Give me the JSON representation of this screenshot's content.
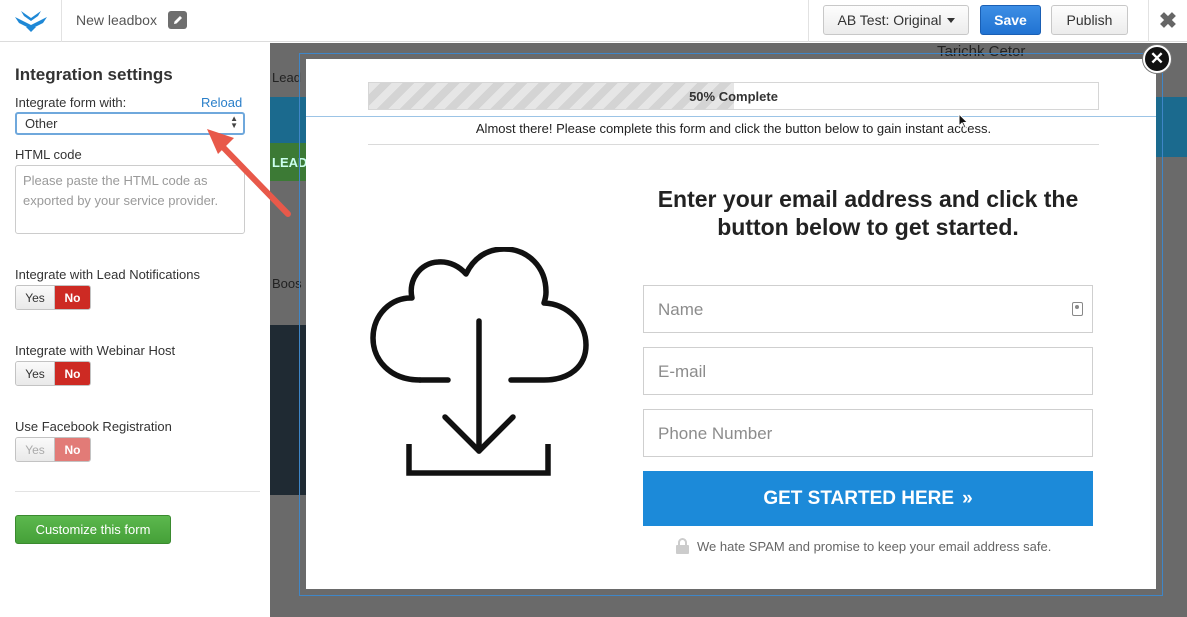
{
  "topbar": {
    "title": "New leadbox",
    "ab_test_label": "AB Test: Original",
    "save_label": "Save",
    "publish_label": "Publish",
    "close_glyph": "✖"
  },
  "sidebar": {
    "heading": "Integration settings",
    "integrate_label": "Integrate form with:",
    "reload_label": "Reload",
    "integration_select": {
      "selected": "Other"
    },
    "html_code_label": "HTML code",
    "html_code_placeholder": "Please paste the HTML code as exported by your service provider.",
    "toggles": [
      {
        "label": "Integrate with Lead Notifications",
        "yes": "Yes",
        "no": "No",
        "value": "No",
        "disabled": false
      },
      {
        "label": "Integrate with Webinar Host",
        "yes": "Yes",
        "no": "No",
        "value": "No",
        "disabled": false
      },
      {
        "label": "Use Facebook Registration",
        "yes": "Yes",
        "no": "No",
        "value": "No",
        "disabled": true
      }
    ],
    "customize_label": "Customize this form"
  },
  "background_page": {
    "text_fragments": [
      "Lead",
      "LEAD",
      "Boos",
      "Tarichk Cetor"
    ]
  },
  "modal": {
    "progress": {
      "percent": 50,
      "label": "50% Complete"
    },
    "subnote": "Almost there! Please complete this form and click the button below to gain instant access.",
    "headline": "Enter your email address and click the button below to get started.",
    "fields": [
      {
        "placeholder": "Name"
      },
      {
        "placeholder": "E-mail"
      },
      {
        "placeholder": "Phone Number"
      }
    ],
    "cta_label": "GET STARTED HERE",
    "cta_glyph": "»",
    "spam_note": "We hate SPAM and promise to keep your email address safe.",
    "close_glyph": "✕"
  },
  "colors": {
    "save_blue": "#2173d2",
    "cta_blue": "#1c8ad9",
    "toggle_no_red": "#cd2a23",
    "customize_green": "#45a038",
    "annotation_arrow": "#e8594a",
    "link_blue": "#2a7fc9"
  },
  "icons": [
    "leadpages-logo-icon",
    "pencil-edit-icon",
    "caret-down-icon",
    "close-icon",
    "select-arrows-icon",
    "cloud-download-icon",
    "contact-card-icon",
    "lock-icon",
    "mouse-pointer-icon",
    "annotation-arrow-icon"
  ]
}
